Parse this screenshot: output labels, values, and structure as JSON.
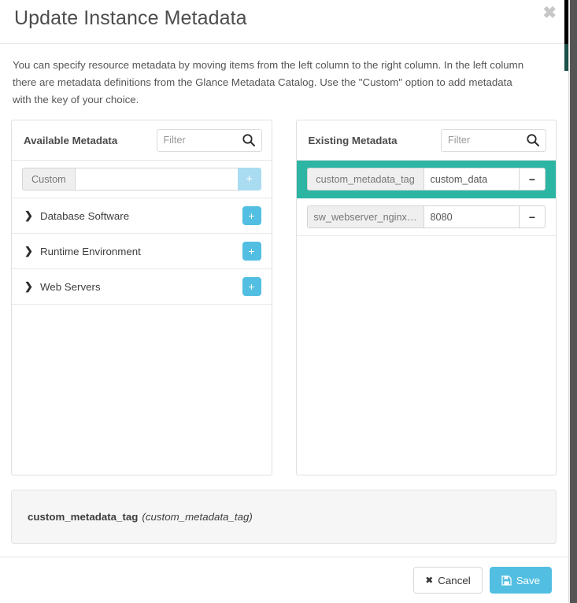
{
  "modal": {
    "title": "Update Instance Metadata",
    "close_label": "✖",
    "intro": "You can specify resource metadata by moving items from the left column to the right column. In the left column there are metadata definitions from the Glance Metadata Catalog. Use the \"Custom\" option to add metadata with the key of your choice."
  },
  "available": {
    "title": "Available Metadata",
    "filter_placeholder": "Filter",
    "filter_value": "",
    "search_icon": "search-icon",
    "custom": {
      "addon_label": "Custom",
      "input_value": "",
      "input_placeholder": "",
      "add_label": "+"
    },
    "categories": [
      {
        "label": "Database Software",
        "chevron": "❯",
        "add_label": "+"
      },
      {
        "label": "Runtime Environment",
        "chevron": "❯",
        "add_label": "+"
      },
      {
        "label": "Web Servers",
        "chevron": "❯",
        "add_label": "+"
      }
    ]
  },
  "existing": {
    "title": "Existing Metadata",
    "filter_placeholder": "Filter",
    "filter_value": "",
    "search_icon": "search-icon",
    "rows": [
      {
        "key": "custom_metadata_tag",
        "value": "custom_data",
        "remove_label": "−",
        "selected": true
      },
      {
        "key": "sw_webserver_nginx…",
        "value": "8080",
        "remove_label": "−",
        "selected": false
      }
    ]
  },
  "detail": {
    "name": "custom_metadata_tag",
    "description": "(custom_metadata_tag)"
  },
  "footer": {
    "cancel_label": "Cancel",
    "cancel_icon": "✖",
    "save_label": "Save",
    "save_icon": "💾"
  },
  "colors": {
    "accent_blue": "#52bfe2",
    "accent_blue_light": "#a9dcf0",
    "selected_teal": "#2db5a3",
    "panel_border": "#e0e0e0",
    "detail_bg": "#f6f6f6",
    "scrollbar_thumb": "#555555"
  }
}
